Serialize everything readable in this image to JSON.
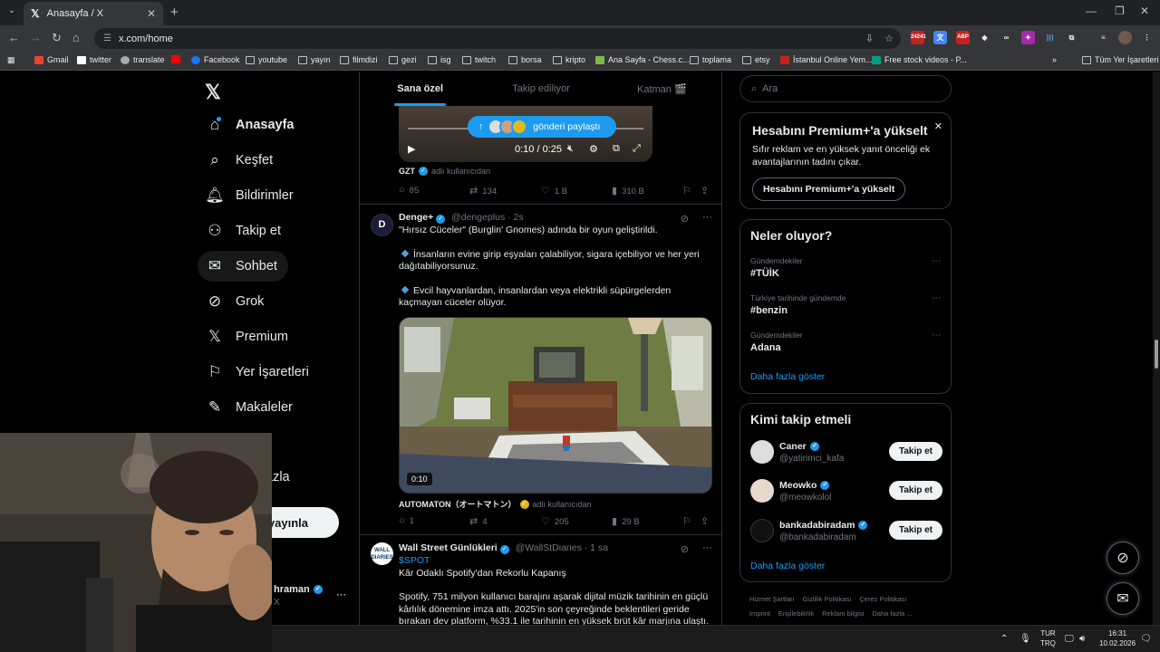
{
  "browser": {
    "tab_title": "Anasayfa / X",
    "url": "x.com/home",
    "extension_badge": "24241",
    "extension_abp": "ABP",
    "bookmarks": [
      "Gmail",
      "twitter",
      "translate",
      "Facebook",
      "youtube",
      "yayın",
      "filmdizi",
      "gezi",
      "isg",
      "twitch",
      "borsa",
      "kripto",
      "Ana Sayfa - Chess.c...",
      "toplama",
      "etsy",
      "İstanbul Online Yem...",
      "Free stock videos - P...",
      "Tüm Yer İşaretleri"
    ]
  },
  "sidebar": {
    "items": [
      {
        "label": "Anasayfa",
        "icon": "home-icon"
      },
      {
        "label": "Keşfet",
        "icon": "search-icon"
      },
      {
        "label": "Bildirimler",
        "icon": "bell-icon"
      },
      {
        "label": "Takip et",
        "icon": "add-person-icon"
      },
      {
        "label": "Sohbet",
        "icon": "mail-icon"
      },
      {
        "label": "Grok",
        "icon": "grok-icon"
      },
      {
        "label": "Premium",
        "icon": "x-icon"
      },
      {
        "label": "Yer İşaretleri",
        "icon": "bookmark-icon"
      },
      {
        "label": "Makaleler",
        "icon": "article-icon"
      }
    ],
    "more_partial": "azla",
    "post_button_partial": "yayınla",
    "profile_name_partial": "hraman",
    "profile_handle_partial": "X"
  },
  "feed": {
    "tabs": [
      "Sana özel",
      "Takip ediliyor",
      "Katman 🎬"
    ],
    "share_pill": "gönderi paylaştı",
    "post1": {
      "video_time": "0:10 / 0:25",
      "source": "GZT",
      "source_note": "adlı kullanıcıdan",
      "replies": "85",
      "reposts": "134",
      "likes": "1 B",
      "views": "310 B"
    },
    "post2": {
      "name": "Denge+",
      "handle": "@dengeplus",
      "time": "· 2s",
      "line1": "\"Hırsız Cüceler\" (Burglin' Gnomes) adında bir oyun geliştirildi.",
      "line2": "İnsanların evine girip eşyaları çalabiliyor, sigara içebiliyor ve her yeri dağıtabiliyorsunuz.",
      "line3": "Evcil hayvanlardan, insanlardan veya elektrikli süpürgelerden kaçmayan cüceler olüyor.",
      "duration": "0:10",
      "source": "AUTOMATON（オートマトン）",
      "source_note": "adlı kullanıcıdan",
      "replies": "1",
      "reposts": "4",
      "likes": "205",
      "views": "29 B"
    },
    "post3": {
      "name": "Wall Street Günlükleri",
      "handle": "@WallStDiaries",
      "time": "· 1 sa",
      "cashtag": "$SPOT",
      "line1": "Kâr Odaklı Spotify'dan Rekorlu Kapanış",
      "line2": "Spotify, 751 milyon kullanıcı barajını aşarak dijital müzik tarihinin en güçlü kârlılık dönemine imza attı. 2025'in son çeyreğinde beklentileri geride bırakan dev platform, %33.1 ile tarihinin en yüksek brüt kâr marjına ulaştı."
    }
  },
  "right": {
    "search_placeholder": "Ara",
    "premium": {
      "title": "Hesabını Premium+'a yükselt",
      "desc": "Sıfır reklam ve en yüksek yanıt önceliği ek avantajlarının tadını çıkar.",
      "button": "Hesabını Premium+'a yükselt"
    },
    "trends": {
      "title": "Neler oluyor?",
      "items": [
        {
          "context": "Gündemdekiler",
          "name": "#TÜİK"
        },
        {
          "context": "Türkiye tarihinde gündemde",
          "name": "#benzin"
        },
        {
          "context": "Gündemdekiler",
          "name": "Adana"
        }
      ],
      "show_more": "Daha fazla göster"
    },
    "who_to_follow": {
      "title": "Kimi takip etmeli",
      "users": [
        {
          "name": "Caner",
          "handle": "@yatirimci_kafa",
          "button": "Takip et"
        },
        {
          "name": "Meowko",
          "handle": "@meowkolol",
          "button": "Takip et"
        },
        {
          "name": "bankadabiradam",
          "handle": "@bankadabiradam",
          "button": "Takip et"
        }
      ],
      "show_more": "Daha fazla göster"
    },
    "footer": [
      "Hizmet Şartları",
      "Gizlilik Politikası",
      "Çerez Politikası",
      "Imprint",
      "Erişilebilirlik",
      "Reklam bilgisi",
      "Daha fazla ..."
    ]
  },
  "taskbar": {
    "lang_top": "TUR",
    "lang_bottom": "TRQ",
    "time": "16:31",
    "date": "10.02.2026"
  }
}
